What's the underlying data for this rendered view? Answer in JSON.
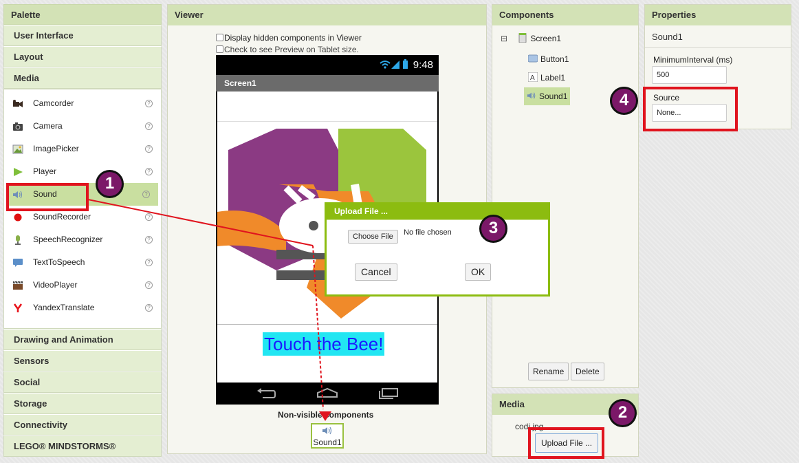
{
  "palette": {
    "title": "Palette",
    "categories_top": [
      "User Interface",
      "Layout",
      "Media"
    ],
    "media_items": [
      {
        "label": "Camcorder",
        "icon": "camcorder-icon"
      },
      {
        "label": "Camera",
        "icon": "camera-icon"
      },
      {
        "label": "ImagePicker",
        "icon": "imagepicker-icon"
      },
      {
        "label": "Player",
        "icon": "player-icon"
      },
      {
        "label": "Sound",
        "icon": "sound-icon"
      },
      {
        "label": "SoundRecorder",
        "icon": "soundrecorder-icon"
      },
      {
        "label": "SpeechRecognizer",
        "icon": "speechrecognizer-icon"
      },
      {
        "label": "TextToSpeech",
        "icon": "texttospeech-icon"
      },
      {
        "label": "VideoPlayer",
        "icon": "videoplayer-icon"
      },
      {
        "label": "YandexTranslate",
        "icon": "yandex-icon"
      }
    ],
    "help_glyph": "?",
    "categories_bottom": [
      "Drawing and Animation",
      "Sensors",
      "Social",
      "Storage",
      "Connectivity",
      "LEGO® MINDSTORMS®"
    ]
  },
  "viewer": {
    "title": "Viewer",
    "check_hidden": "Display hidden components in Viewer",
    "check_tablet": "Check to see Preview on Tablet size.",
    "time": "9:48",
    "screen_title": "Screen1",
    "touch_label": "Touch the Bee!",
    "nonvisible_label": "Non-visible components",
    "nonvisible_item": "Sound1"
  },
  "components": {
    "title": "Components",
    "collapse_glyph": "⊟",
    "tree": [
      {
        "label": "Screen1"
      },
      {
        "label": "Button1"
      },
      {
        "label": "Label1"
      },
      {
        "label": "Sound1"
      }
    ],
    "rename": "Rename",
    "delete": "Delete"
  },
  "media": {
    "title": "Media",
    "file": "codi.jpg",
    "upload": "Upload File ..."
  },
  "properties": {
    "title": "Properties",
    "component": "Sound1",
    "min_interval_label": "MinimumInterval (ms)",
    "min_interval_value": "500",
    "source_label": "Source",
    "source_value": "None..."
  },
  "dialog": {
    "title": "Upload File ...",
    "choose": "Choose File",
    "no_file": "No file chosen",
    "cancel": "Cancel",
    "ok": "OK"
  },
  "badges": [
    "1",
    "2",
    "3",
    "4"
  ],
  "colors": {
    "accent": "#8cbc10",
    "annotation": "#e0141e",
    "badge": "#7b1868"
  }
}
